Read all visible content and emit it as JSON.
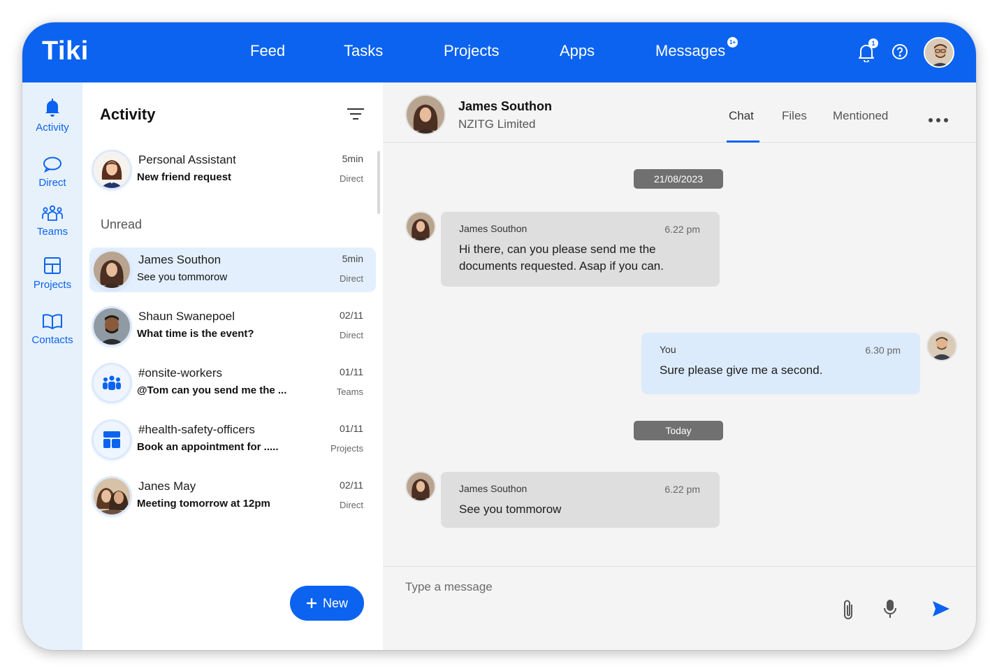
{
  "brand": "Tiki",
  "nav": [
    {
      "label": "Feed"
    },
    {
      "label": "Tasks"
    },
    {
      "label": "Projects"
    },
    {
      "label": "Apps"
    },
    {
      "label": "Messages",
      "badge": "1+"
    }
  ],
  "topbar": {
    "notification_count": "1",
    "accent": "#0b63f0"
  },
  "rail": [
    {
      "label": "Activity",
      "icon": "bell-icon"
    },
    {
      "label": "Direct",
      "icon": "chat-bubble-icon"
    },
    {
      "label": "Teams",
      "icon": "team-icon"
    },
    {
      "label": "Projects",
      "icon": "layout-icon"
    },
    {
      "label": "Contacts",
      "icon": "book-icon"
    }
  ],
  "activity": {
    "title": "Activity",
    "unread_label": "Unread",
    "pinned": {
      "name": "Personal Assistant",
      "preview": "New friend request",
      "time": "5min",
      "type": "Direct"
    },
    "conversations": [
      {
        "name": "James Southon",
        "preview": "See you tommorow",
        "time": "5min",
        "type": "Direct"
      },
      {
        "name": "Shaun Swanepoel",
        "preview": "What time is the event?",
        "time": "02/11",
        "type": "Direct"
      },
      {
        "name": "#onsite-workers",
        "preview": "@Tom can you send me the ...",
        "time": "01/11",
        "type": "Teams"
      },
      {
        "name": "#health-safety-officers",
        "preview": "Book an appointment for .....",
        "time": "01/11",
        "type": "Projects"
      },
      {
        "name": "Janes May",
        "preview": "Meeting tomorrow at 12pm",
        "time": "02/11",
        "type": "Direct"
      }
    ],
    "new_button": "New"
  },
  "chat": {
    "contact_name": "James Southon",
    "contact_company": "NZITG Limited",
    "tabs": [
      "Chat",
      "Files",
      "Mentioned"
    ],
    "active_tab": "Chat",
    "dates": [
      "21/08/2023",
      "Today"
    ],
    "messages": [
      {
        "sender": "James Southon",
        "time": "6.22 pm",
        "text": "Hi there, can you please send me the documents requested. Asap if you can."
      },
      {
        "sender": "You",
        "time": "6.30 pm",
        "text": "Sure please give me a second."
      },
      {
        "sender": "James Southon",
        "time": "6.22 pm",
        "text": "See you tommorow"
      }
    ],
    "composer_placeholder": "Type a message"
  }
}
